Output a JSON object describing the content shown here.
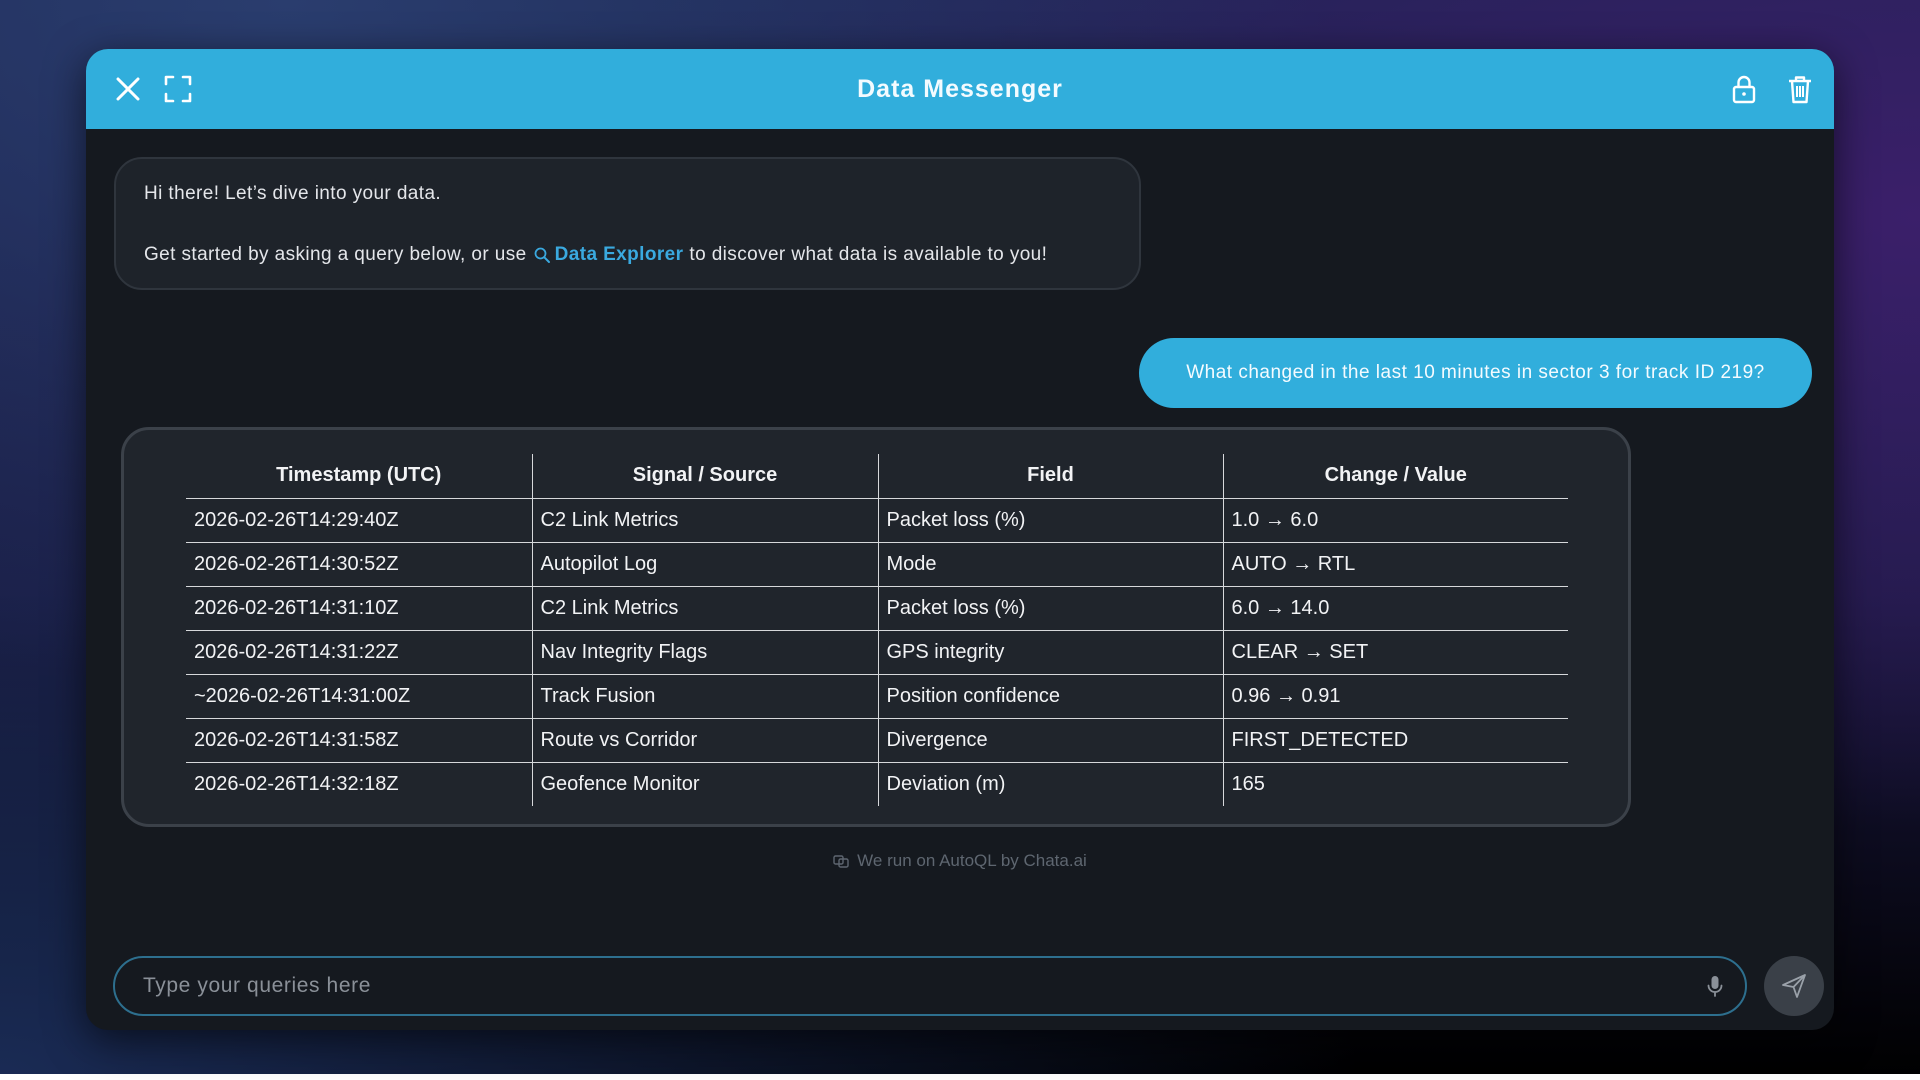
{
  "header": {
    "title": "Data Messenger",
    "icons": [
      "close-icon",
      "fullscreen-icon",
      "lock-icon",
      "trash-icon"
    ]
  },
  "messages": {
    "bot": {
      "line1": "Hi there! Let’s dive into your data.",
      "line2_prefix": "Get started by asking a query below, or use",
      "link_label": "Data Explorer",
      "line2_suffix": "to discover what data is available to you!"
    },
    "user": {
      "text": "What changed in the last 10 minutes in sector 3 for track ID 219?"
    }
  },
  "table": {
    "columns": [
      "Timestamp (UTC)",
      "Signal / Source",
      "Field",
      "Change / Value"
    ],
    "rows": [
      [
        "2026-02-26T14:29:40Z",
        "C2 Link Metrics",
        "Packet loss (%)",
        "1.0 → 6.0"
      ],
      [
        "2026-02-26T14:30:52Z",
        "Autopilot Log",
        "Mode",
        "AUTO → RTL"
      ],
      [
        "2026-02-26T14:31:10Z",
        "C2 Link Metrics",
        "Packet loss (%)",
        "6.0 → 14.0"
      ],
      [
        "2026-02-26T14:31:22Z",
        "Nav Integrity Flags",
        "GPS integrity",
        "CLEAR → SET"
      ],
      [
        "~2026-02-26T14:31:00Z",
        "Track Fusion",
        "Position confidence",
        "0.96 → 0.91"
      ],
      [
        "2026-02-26T14:31:58Z",
        "Route vs Corridor",
        "Divergence",
        "FIRST_DETECTED"
      ],
      [
        "2026-02-26T14:32:18Z",
        "Geofence Monitor",
        "Deviation (m)",
        "165"
      ]
    ]
  },
  "footer": {
    "powered_by": "We run on AutoQL by Chata.ai"
  },
  "input": {
    "placeholder": "Type your queries here",
    "value": ""
  },
  "colors": {
    "accent": "#31aedc",
    "link": "#3aa9df",
    "panel": "#15191f"
  }
}
